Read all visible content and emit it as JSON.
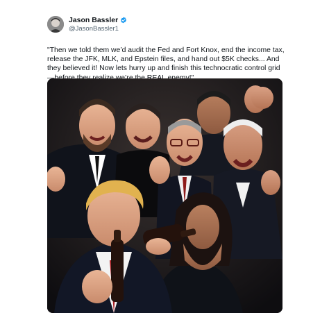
{
  "tweet": {
    "author_name": "Jason Bassler",
    "author_handle": "@JasonBassler1",
    "verified_icon": "verified-badge-icon",
    "verified_color": "#1d9bf0",
    "text": "\"Then we told them we’d audit the Fed and Fort Knox, end the income tax, release the JFK, MLK, and Epstein files, and hand out $5K checks... And they believed it! Now lets hurry up and finish this technocratic control grid—before they realize we’re the REAL enemy!\"",
    "media_description_icon": "photo-image"
  }
}
